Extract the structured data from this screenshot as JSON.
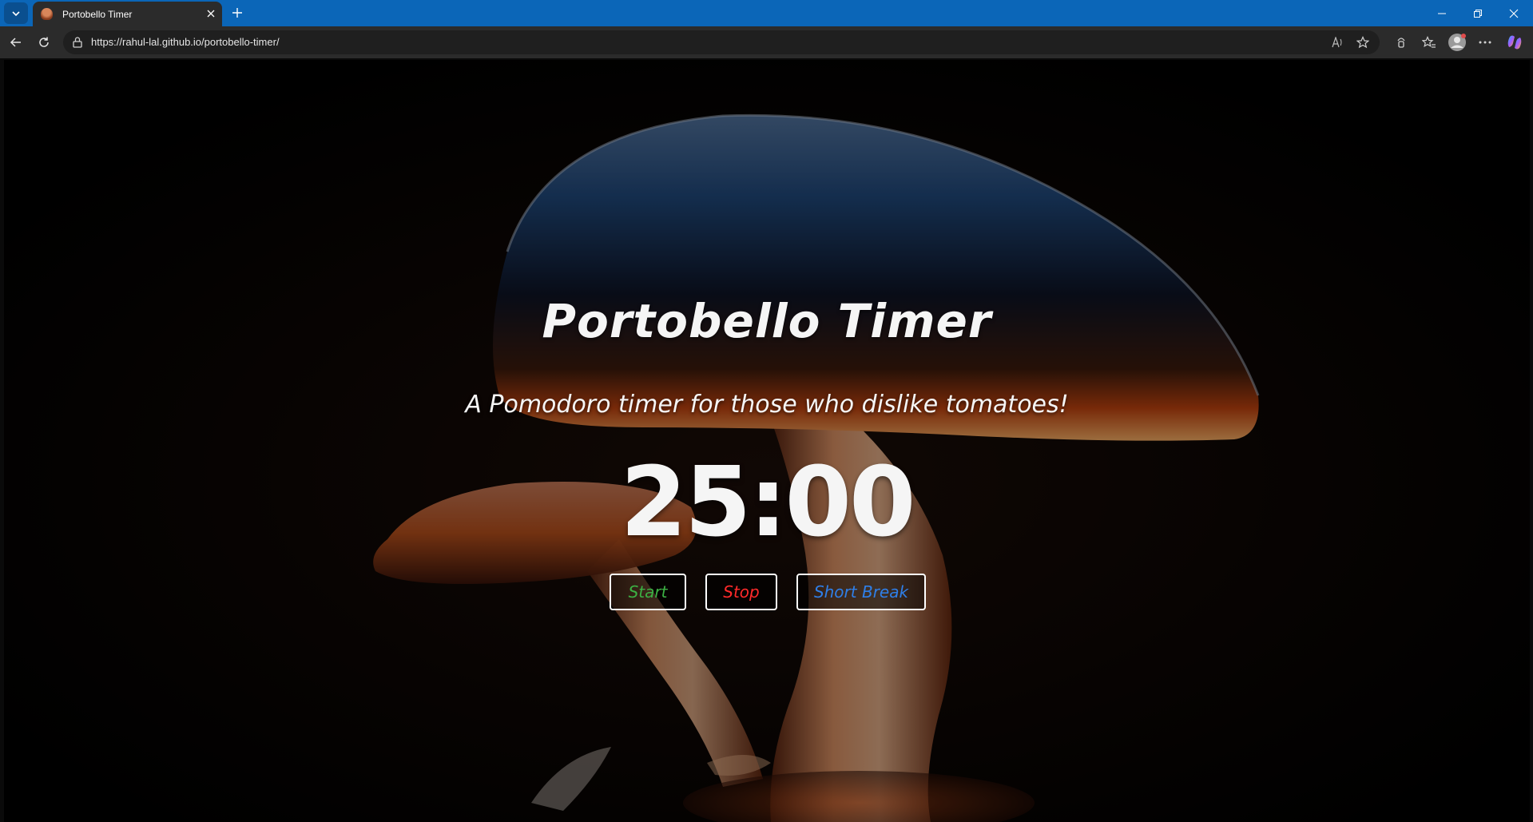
{
  "browser": {
    "tab_title": "Portobello Timer",
    "url": "https://rahul-lal.github.io/portobello-timer/"
  },
  "page": {
    "title": "Portobello Timer",
    "tagline": "A Pomodoro timer for those who dislike tomatoes!",
    "timer": "25:00",
    "buttons": {
      "start": "Start",
      "stop": "Stop",
      "short_break": "Short Break"
    }
  },
  "colors": {
    "titlebar": "#0b66b8",
    "start": "#3cb043",
    "stop": "#ff2a2a",
    "short_break": "#2f7fe8"
  },
  "icons": [
    "tab-list-icon",
    "favicon-mushroom-icon",
    "close-icon",
    "plus-icon",
    "minimize-icon",
    "restore-icon",
    "window-close-icon",
    "back-icon",
    "refresh-icon",
    "lock-icon",
    "read-aloud-icon",
    "favorite-star-icon",
    "browser-essentials-icon",
    "favorites-icon",
    "profile-avatar-icon",
    "more-icon",
    "copilot-icon"
  ]
}
